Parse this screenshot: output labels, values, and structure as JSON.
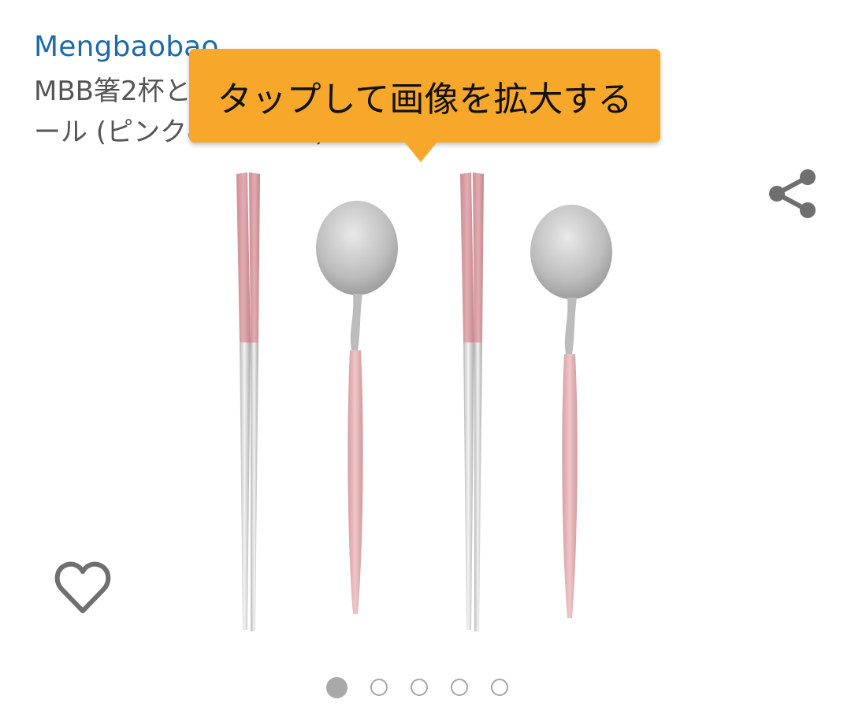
{
  "product": {
    "brand": "Mengbaobao",
    "title_line1": "MBB箸2杯と2スプーンセットステンレススチ",
    "title_line2": "ール (ピンク&シルバー)"
  },
  "tooltip": {
    "text": "タップして画像を拡大する"
  },
  "image": {
    "alt": "ピンク&シルバーの箸2膳とスプーン2本"
  },
  "icons": {
    "share": "share-icon",
    "favorite": "heart-icon"
  },
  "carousel": {
    "total": 5,
    "active_index": 0
  },
  "colors": {
    "brand_link": "#1e6aa8",
    "tooltip_bg": "#f7a729",
    "icon_gray": "#6f6f6f",
    "pink": "#d9a3a6",
    "silver": "#cfcfcf"
  }
}
